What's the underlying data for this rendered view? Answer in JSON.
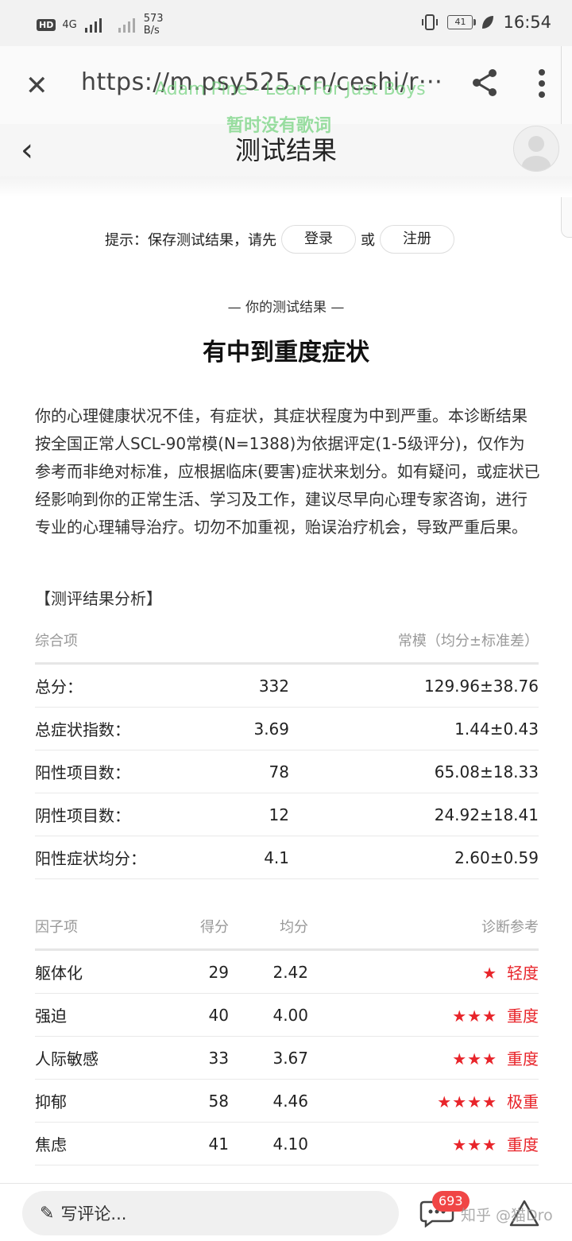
{
  "status_bar": {
    "hd": "HD",
    "network": "4G",
    "speed_value": "573",
    "speed_unit": "B/s",
    "battery": "41",
    "time": "16:54"
  },
  "browser": {
    "url": "https://m.psy525.cn/ceshi/r···",
    "watermark_line1": "Adam Pine - Lean For Just Boys",
    "watermark_line2": "暂时没有歌词"
  },
  "page": {
    "title": "测试结果",
    "hint_text": "提示：保存测试结果，请先",
    "login_label": "登录",
    "or_text": "或",
    "register_label": "注册",
    "result_subhead": "— 你的测试结果 —",
    "result_headline": "有中到重度症状",
    "description": "你的心理健康状况不佳，有症状，其症状程度为中到严重。本诊断结果按全国正常人SCL-90常模(N=1388)为依据评定(1-5级评分)，仅作为参考而非绝对标准，应根据临床(要害)症状来划分。如有疑问，或症状已经影响到你的正常生活、学习及工作，建议尽早向心理专家咨询，进行专业的心理辅导治疗。切勿不加重视，贻误治疗机会，导致严重后果。",
    "analysis_label": "【测评结果分析】"
  },
  "summary_table": {
    "headers": {
      "item": "综合项",
      "norm": "常模（均分±标准差）"
    },
    "rows": [
      {
        "label": "总分：",
        "value": "332",
        "norm": "129.96±38.76"
      },
      {
        "label": "总症状指数：",
        "value": "3.69",
        "norm": "1.44±0.43"
      },
      {
        "label": "阳性项目数：",
        "value": "78",
        "norm": "65.08±18.33"
      },
      {
        "label": "阴性项目数：",
        "value": "12",
        "norm": "24.92±18.41"
      },
      {
        "label": "阳性症状均分：",
        "value": "4.1",
        "norm": "2.60±0.59"
      }
    ]
  },
  "factor_table": {
    "headers": {
      "factor": "因子项",
      "score": "得分",
      "avg": "均分",
      "diagnosis": "诊断参考"
    },
    "rows": [
      {
        "factor": "躯体化",
        "score": "29",
        "avg": "2.42",
        "stars": "★",
        "level": "轻度"
      },
      {
        "factor": "强迫",
        "score": "40",
        "avg": "4.00",
        "stars": "★★★",
        "level": "重度"
      },
      {
        "factor": "人际敏感",
        "score": "33",
        "avg": "3.67",
        "stars": "★★★",
        "level": "重度"
      },
      {
        "factor": "抑郁",
        "score": "58",
        "avg": "4.46",
        "stars": "★★★★",
        "level": "极重"
      },
      {
        "factor": "焦虑",
        "score": "41",
        "avg": "4.10",
        "stars": "★★★",
        "level": "重度"
      }
    ]
  },
  "bottom_bar": {
    "comment_placeholder": "写评论...",
    "comment_count": "693",
    "zhihu_watermark": "知乎 @猫Dro"
  },
  "colors": {
    "accent_red": "#e8242a",
    "badge_red": "#f04646"
  }
}
